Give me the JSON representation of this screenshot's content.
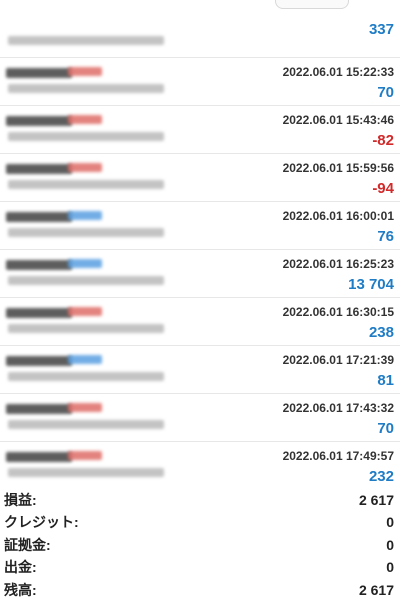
{
  "deals": [
    {
      "date_time": "",
      "profit": "337",
      "profit_color": "#1f7cc5",
      "action_type": "",
      "symbol": "",
      "prices": "",
      "first_row": true
    },
    {
      "date_time": "2022.06.01 15:22:33",
      "profit": "70",
      "profit_color": "#1f7cc5",
      "action_type": "sell",
      "symbol": "",
      "prices": ""
    },
    {
      "date_time": "2022.06.01 15:43:46",
      "profit": "-82",
      "profit_color": "#d22a2a",
      "action_type": "sell",
      "symbol": "",
      "prices": ""
    },
    {
      "date_time": "2022.06.01 15:59:56",
      "profit": "-94",
      "profit_color": "#d22a2a",
      "action_type": "sell",
      "symbol": "",
      "prices": ""
    },
    {
      "date_time": "2022.06.01 16:00:01",
      "profit": "76",
      "profit_color": "#1f7cc5",
      "action_type": "buy",
      "symbol": "",
      "prices": ""
    },
    {
      "date_time": "2022.06.01 16:25:23",
      "profit": "13 704",
      "profit_color": "#1f7cc5",
      "action_type": "buy",
      "symbol": "",
      "prices": ""
    },
    {
      "date_time": "2022.06.01 16:30:15",
      "profit": "238",
      "profit_color": "#1f7cc5",
      "action_type": "sell",
      "symbol": "",
      "prices": ""
    },
    {
      "date_time": "2022.06.01 17:21:39",
      "profit": "81",
      "profit_color": "#1f7cc5",
      "action_type": "buy",
      "symbol": "",
      "prices": ""
    },
    {
      "date_time": "2022.06.01 17:43:32",
      "profit": "70",
      "profit_color": "#1f7cc5",
      "action_type": "sell",
      "symbol": "",
      "prices": ""
    },
    {
      "date_time": "2022.06.01 17:49:57",
      "profit": "232",
      "profit_color": "#1f7cc5",
      "action_type": "sell",
      "symbol": "",
      "prices": ""
    }
  ],
  "summary": [
    {
      "label": "損益:",
      "value": "2 617"
    },
    {
      "label": "クレジット:",
      "value": "0"
    },
    {
      "label": "証拠金:",
      "value": "0"
    },
    {
      "label": "出金:",
      "value": "0"
    },
    {
      "label": "残高:",
      "value": "2 617"
    }
  ]
}
